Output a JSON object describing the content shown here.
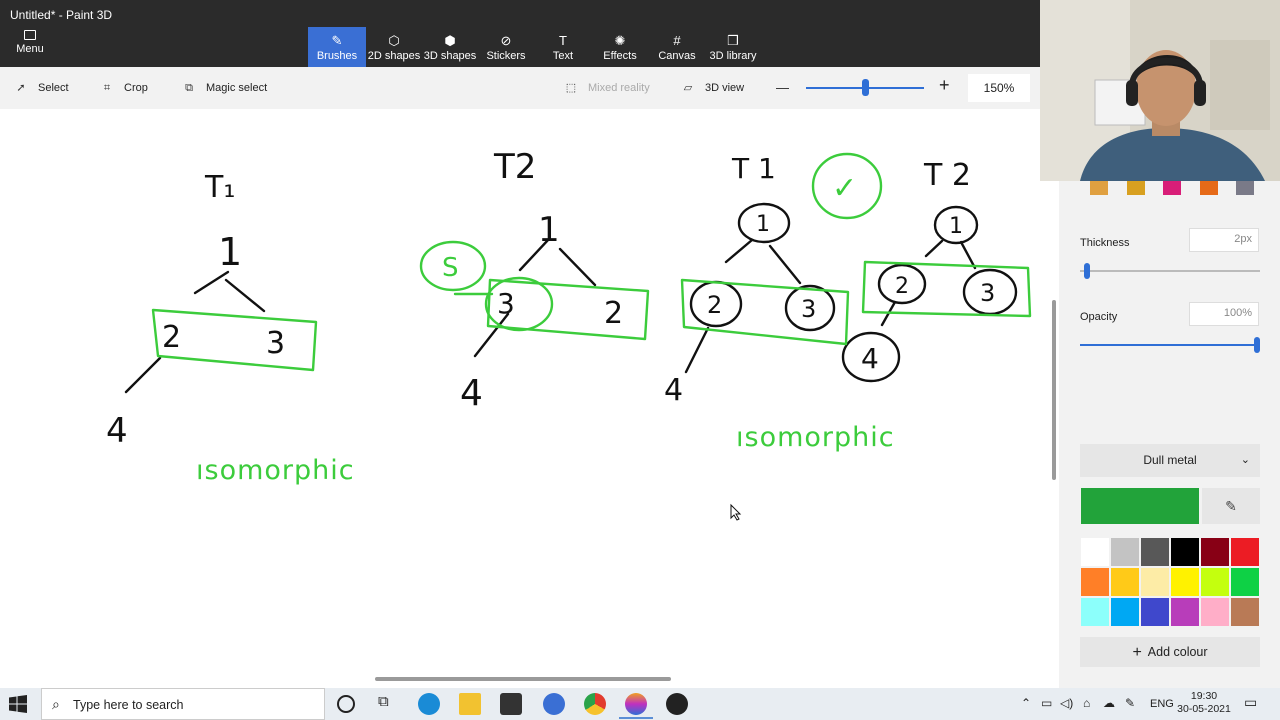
{
  "window": {
    "title": "Untitled* - Paint 3D"
  },
  "menu": {
    "label": "Menu"
  },
  "ribbon": {
    "tools": [
      {
        "label": "Brushes",
        "icon": "brush-icon",
        "glyph": "✎",
        "active": true
      },
      {
        "label": "2D shapes",
        "icon": "2d-shapes-icon",
        "glyph": "⬡",
        "active": false
      },
      {
        "label": "3D shapes",
        "icon": "3d-shapes-icon",
        "glyph": "⬢",
        "active": false
      },
      {
        "label": "Stickers",
        "icon": "stickers-icon",
        "glyph": "⊘",
        "active": false
      },
      {
        "label": "Text",
        "icon": "text-icon",
        "glyph": "T",
        "active": false
      },
      {
        "label": "Effects",
        "icon": "effects-icon",
        "glyph": "✺",
        "active": false
      },
      {
        "label": "Canvas",
        "icon": "canvas-icon",
        "glyph": "#",
        "active": false
      },
      {
        "label": "3D library",
        "icon": "3d-library-icon",
        "glyph": "❒",
        "active": false
      }
    ]
  },
  "toolbar": {
    "select_label": "Select",
    "crop_label": "Crop",
    "magic_select_label": "Magic select",
    "mixed_reality_label": "Mixed reality",
    "view3d_label": "3D view",
    "zoom_out": "—",
    "zoom_in": "+",
    "zoom_value": "150%"
  },
  "canvas": {
    "left_tree": {
      "title": "T₁",
      "root": "1",
      "children": [
        "2",
        "3"
      ],
      "leaf": "4",
      "caption": "ısomorphic"
    },
    "mid_tree": {
      "title": "T2",
      "root": "1",
      "children": [
        "3",
        "2"
      ],
      "leaf": "4",
      "swap_mark": "S"
    },
    "right_trees": {
      "t1_title": "T 1",
      "t2_title": "T 2",
      "t1_nodes": [
        "1",
        "2",
        "3",
        "4"
      ],
      "t2_nodes": [
        "1",
        "2",
        "3",
        "4"
      ],
      "check_mark": "✓",
      "caption": "ısomorphic"
    }
  },
  "panel": {
    "thickness_label": "Thickness",
    "thickness_value": "2px",
    "thickness_level": 0.02,
    "opacity_label": "Opacity",
    "opacity_value": "100%",
    "opacity_level": 1.0,
    "material": "Dull metal",
    "current_colour": "#22a33a",
    "palette": [
      "#ffffff",
      "#c3c3c3",
      "#585858",
      "#000000",
      "#880015",
      "#ec1c24",
      "#ff7f27",
      "#ffca18",
      "#fdeca6",
      "#fff200",
      "#c4ff0e",
      "#0ed145",
      "#8cfffb",
      "#00a8f3",
      "#3f48cc",
      "#b83dba",
      "#ffaec8",
      "#b97a56"
    ],
    "add_colour_label": "Add colour"
  },
  "taskbar": {
    "search_placeholder": "Type here to search",
    "language": "ENG",
    "time": "19:30",
    "date": "30-05-2021"
  },
  "colors": {
    "ink": "#111111",
    "marker": "#3ccc3c",
    "accent": "#3a6fd4",
    "ribbon_bg": "#2b2b2b"
  }
}
